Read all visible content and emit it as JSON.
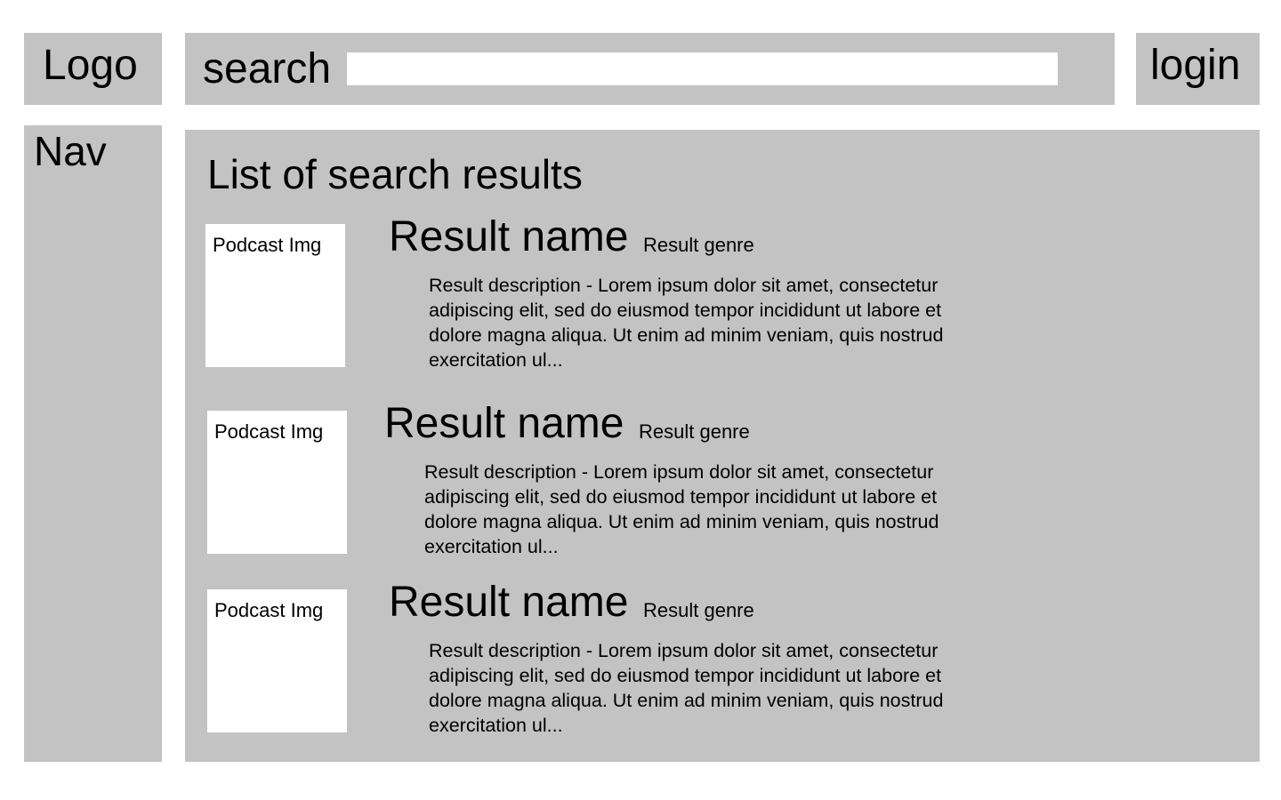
{
  "header": {
    "logo": "Logo",
    "search_label": "search",
    "search_value": "",
    "search_placeholder": "",
    "login_label": "login"
  },
  "nav": {
    "label": "Nav"
  },
  "main": {
    "heading": "List of search results",
    "results": [
      {
        "image_label": "Podcast Img",
        "name": "Result name",
        "genre": "Result genre",
        "description": "Result description - Lorem ipsum dolor sit amet, consectetur adipiscing elit, sed do eiusmod tempor incididunt ut labore et dolore magna aliqua. Ut enim ad minim veniam, quis nostrud exercitation ul..."
      },
      {
        "image_label": "Podcast Img",
        "name": "Result name",
        "genre": "Result genre",
        "description": "Result description - Lorem ipsum dolor sit amet, consectetur adipiscing elit, sed do eiusmod tempor incididunt ut labore et dolore magna aliqua. Ut enim ad minim veniam, quis nostrud exercitation ul..."
      },
      {
        "image_label": "Podcast Img",
        "name": "Result name",
        "genre": "Result genre",
        "description": "Result description - Lorem ipsum dolor sit amet, consectetur adipiscing elit, sed do eiusmod tempor incididunt ut labore et dolore magna aliqua. Ut enim ad minim veniam, quis nostrud exercitation ul..."
      }
    ]
  }
}
